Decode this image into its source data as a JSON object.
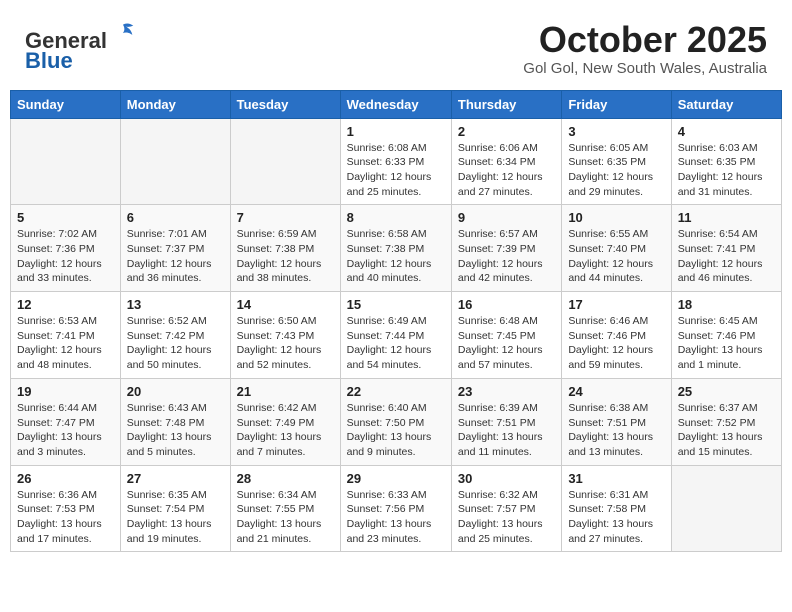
{
  "header": {
    "logo_general": "General",
    "logo_blue": "Blue",
    "title": "October 2025",
    "location": "Gol Gol, New South Wales, Australia"
  },
  "weekdays": [
    "Sunday",
    "Monday",
    "Tuesday",
    "Wednesday",
    "Thursday",
    "Friday",
    "Saturday"
  ],
  "weeks": [
    [
      {
        "day": "",
        "info": ""
      },
      {
        "day": "",
        "info": ""
      },
      {
        "day": "",
        "info": ""
      },
      {
        "day": "1",
        "info": "Sunrise: 6:08 AM\nSunset: 6:33 PM\nDaylight: 12 hours\nand 25 minutes."
      },
      {
        "day": "2",
        "info": "Sunrise: 6:06 AM\nSunset: 6:34 PM\nDaylight: 12 hours\nand 27 minutes."
      },
      {
        "day": "3",
        "info": "Sunrise: 6:05 AM\nSunset: 6:35 PM\nDaylight: 12 hours\nand 29 minutes."
      },
      {
        "day": "4",
        "info": "Sunrise: 6:03 AM\nSunset: 6:35 PM\nDaylight: 12 hours\nand 31 minutes."
      }
    ],
    [
      {
        "day": "5",
        "info": "Sunrise: 7:02 AM\nSunset: 7:36 PM\nDaylight: 12 hours\nand 33 minutes."
      },
      {
        "day": "6",
        "info": "Sunrise: 7:01 AM\nSunset: 7:37 PM\nDaylight: 12 hours\nand 36 minutes."
      },
      {
        "day": "7",
        "info": "Sunrise: 6:59 AM\nSunset: 7:38 PM\nDaylight: 12 hours\nand 38 minutes."
      },
      {
        "day": "8",
        "info": "Sunrise: 6:58 AM\nSunset: 7:38 PM\nDaylight: 12 hours\nand 40 minutes."
      },
      {
        "day": "9",
        "info": "Sunrise: 6:57 AM\nSunset: 7:39 PM\nDaylight: 12 hours\nand 42 minutes."
      },
      {
        "day": "10",
        "info": "Sunrise: 6:55 AM\nSunset: 7:40 PM\nDaylight: 12 hours\nand 44 minutes."
      },
      {
        "day": "11",
        "info": "Sunrise: 6:54 AM\nSunset: 7:41 PM\nDaylight: 12 hours\nand 46 minutes."
      }
    ],
    [
      {
        "day": "12",
        "info": "Sunrise: 6:53 AM\nSunset: 7:41 PM\nDaylight: 12 hours\nand 48 minutes."
      },
      {
        "day": "13",
        "info": "Sunrise: 6:52 AM\nSunset: 7:42 PM\nDaylight: 12 hours\nand 50 minutes."
      },
      {
        "day": "14",
        "info": "Sunrise: 6:50 AM\nSunset: 7:43 PM\nDaylight: 12 hours\nand 52 minutes."
      },
      {
        "day": "15",
        "info": "Sunrise: 6:49 AM\nSunset: 7:44 PM\nDaylight: 12 hours\nand 54 minutes."
      },
      {
        "day": "16",
        "info": "Sunrise: 6:48 AM\nSunset: 7:45 PM\nDaylight: 12 hours\nand 57 minutes."
      },
      {
        "day": "17",
        "info": "Sunrise: 6:46 AM\nSunset: 7:46 PM\nDaylight: 12 hours\nand 59 minutes."
      },
      {
        "day": "18",
        "info": "Sunrise: 6:45 AM\nSunset: 7:46 PM\nDaylight: 13 hours\nand 1 minute."
      }
    ],
    [
      {
        "day": "19",
        "info": "Sunrise: 6:44 AM\nSunset: 7:47 PM\nDaylight: 13 hours\nand 3 minutes."
      },
      {
        "day": "20",
        "info": "Sunrise: 6:43 AM\nSunset: 7:48 PM\nDaylight: 13 hours\nand 5 minutes."
      },
      {
        "day": "21",
        "info": "Sunrise: 6:42 AM\nSunset: 7:49 PM\nDaylight: 13 hours\nand 7 minutes."
      },
      {
        "day": "22",
        "info": "Sunrise: 6:40 AM\nSunset: 7:50 PM\nDaylight: 13 hours\nand 9 minutes."
      },
      {
        "day": "23",
        "info": "Sunrise: 6:39 AM\nSunset: 7:51 PM\nDaylight: 13 hours\nand 11 minutes."
      },
      {
        "day": "24",
        "info": "Sunrise: 6:38 AM\nSunset: 7:51 PM\nDaylight: 13 hours\nand 13 minutes."
      },
      {
        "day": "25",
        "info": "Sunrise: 6:37 AM\nSunset: 7:52 PM\nDaylight: 13 hours\nand 15 minutes."
      }
    ],
    [
      {
        "day": "26",
        "info": "Sunrise: 6:36 AM\nSunset: 7:53 PM\nDaylight: 13 hours\nand 17 minutes."
      },
      {
        "day": "27",
        "info": "Sunrise: 6:35 AM\nSunset: 7:54 PM\nDaylight: 13 hours\nand 19 minutes."
      },
      {
        "day": "28",
        "info": "Sunrise: 6:34 AM\nSunset: 7:55 PM\nDaylight: 13 hours\nand 21 minutes."
      },
      {
        "day": "29",
        "info": "Sunrise: 6:33 AM\nSunset: 7:56 PM\nDaylight: 13 hours\nand 23 minutes."
      },
      {
        "day": "30",
        "info": "Sunrise: 6:32 AM\nSunset: 7:57 PM\nDaylight: 13 hours\nand 25 minutes."
      },
      {
        "day": "31",
        "info": "Sunrise: 6:31 AM\nSunset: 7:58 PM\nDaylight: 13 hours\nand 27 minutes."
      },
      {
        "day": "",
        "info": ""
      }
    ]
  ]
}
